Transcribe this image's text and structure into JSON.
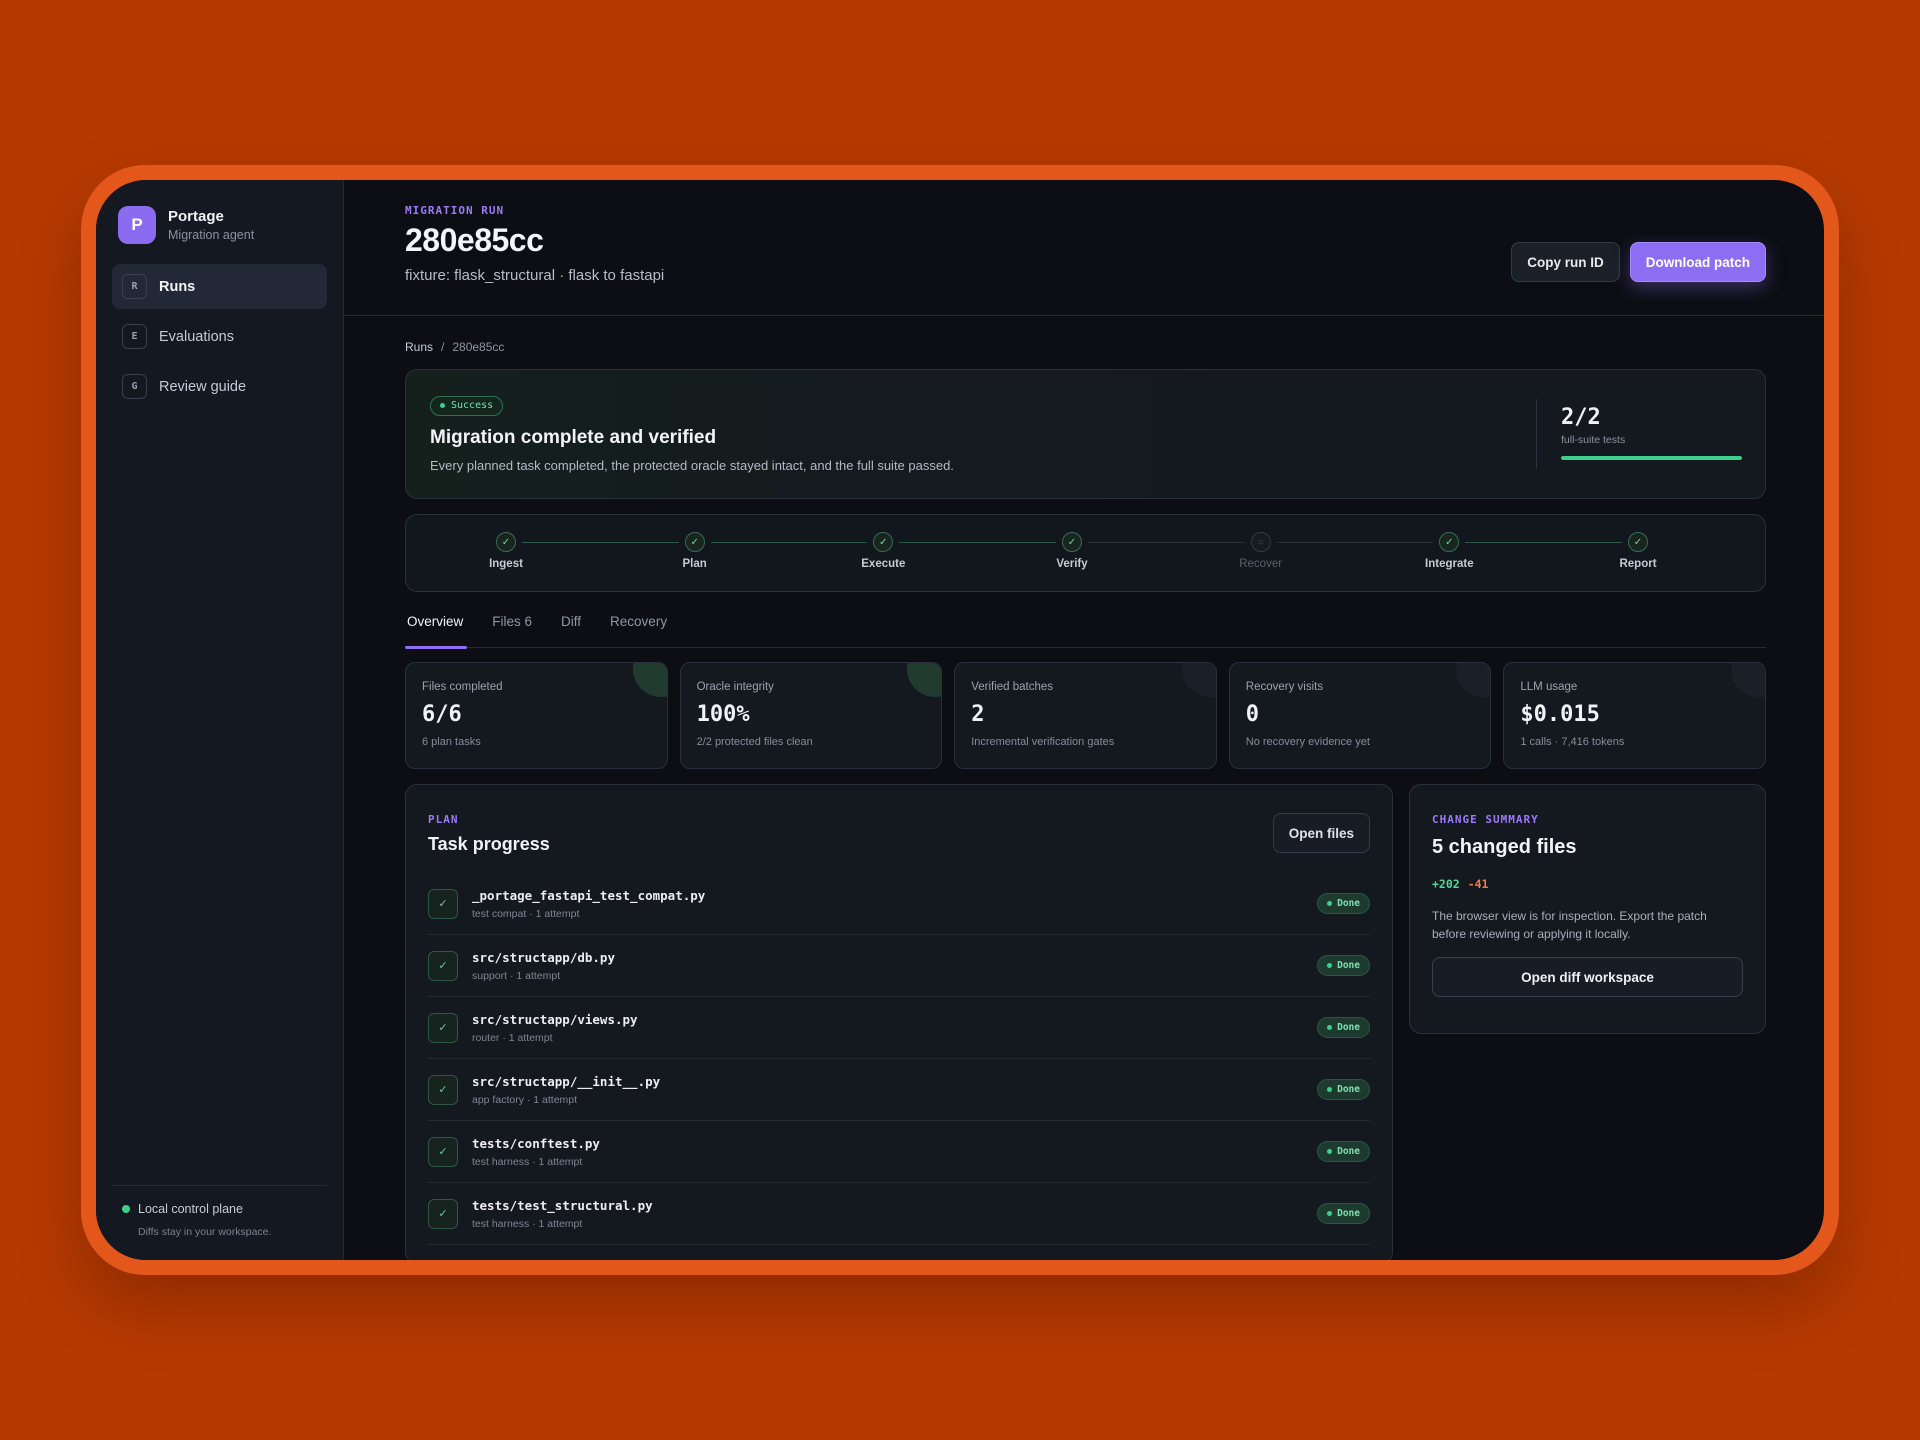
{
  "brand": {
    "logo_letter": "P",
    "name": "Portage",
    "subtitle": "Migration agent"
  },
  "sidebar": {
    "items": [
      {
        "key": "R",
        "label": "Runs",
        "active": true
      },
      {
        "key": "E",
        "label": "Evaluations",
        "active": false
      },
      {
        "key": "G",
        "label": "Review guide",
        "active": false
      }
    ],
    "footer": {
      "status": "Local control plane",
      "note": "Diffs stay in your workspace."
    }
  },
  "header": {
    "eyebrow": "MIGRATION RUN",
    "run_id": "280e85cc",
    "subtitle": "fixture: flask_structural · flask to fastapi",
    "copy_button": "Copy run ID",
    "download_button": "Download patch"
  },
  "breadcrumb": {
    "root": "Runs",
    "separator": "/",
    "current": "280e85cc"
  },
  "status": {
    "badge": "Success",
    "title": "Migration complete and verified",
    "description": "Every planned task completed, the protected oracle stayed intact, and the full suite passed.",
    "ratio": "2/2",
    "ratio_label": "full-suite tests",
    "tests_passed_fraction": 1.0
  },
  "pipeline": {
    "stages": [
      {
        "label": "Ingest",
        "done": true
      },
      {
        "label": "Plan",
        "done": true
      },
      {
        "label": "Execute",
        "done": true
      },
      {
        "label": "Verify",
        "done": true
      },
      {
        "label": "Recover",
        "done": false
      },
      {
        "label": "Integrate",
        "done": true
      },
      {
        "label": "Report",
        "done": true
      }
    ]
  },
  "tabs": [
    {
      "label": "Overview",
      "active": true
    },
    {
      "label": "Files 6",
      "active": false
    },
    {
      "label": "Diff",
      "active": false
    },
    {
      "label": "Recovery",
      "active": false
    }
  ],
  "metrics": [
    {
      "label": "Files completed",
      "value": "6/6",
      "sub": "6 plan tasks",
      "accent": true
    },
    {
      "label": "Oracle integrity",
      "value": "100%",
      "sub": "2/2 protected files clean",
      "accent": true
    },
    {
      "label": "Verified batches",
      "value": "2",
      "sub": "Incremental verification gates",
      "accent": false
    },
    {
      "label": "Recovery visits",
      "value": "0",
      "sub": "No recovery evidence yet",
      "accent": false
    },
    {
      "label": "LLM usage",
      "value": "$0.015",
      "sub": "1 calls · 7,416 tokens",
      "accent": false
    }
  ],
  "plan": {
    "eyebrow": "PLAN",
    "title": "Task progress",
    "open_files_button": "Open files",
    "check_glyph": "✓",
    "tasks": [
      {
        "name": "_portage_fastapi_test_compat.py",
        "meta": "test compat · 1 attempt",
        "status": "Done"
      },
      {
        "name": "src/structapp/db.py",
        "meta": "support · 1 attempt",
        "status": "Done"
      },
      {
        "name": "src/structapp/views.py",
        "meta": "router · 1 attempt",
        "status": "Done"
      },
      {
        "name": "src/structapp/__init__.py",
        "meta": "app factory · 1 attempt",
        "status": "Done"
      },
      {
        "name": "tests/conftest.py",
        "meta": "test harness · 1 attempt",
        "status": "Done"
      },
      {
        "name": "tests/test_structural.py",
        "meta": "test harness · 1 attempt",
        "status": "Done"
      }
    ]
  },
  "summary": {
    "eyebrow": "CHANGE SUMMARY",
    "title": "5 changed files",
    "additions": "+202",
    "deletions": "-41",
    "text": "The browser view is for inspection. Export the patch before reviewing or applying it locally.",
    "button": "Open diff workspace"
  },
  "colors": {
    "page_background": "#b53a01",
    "bezel": "#e4571a",
    "accent": "#8d6ef2",
    "success": "#3ecf8e",
    "deletion": "#f07a4a"
  }
}
